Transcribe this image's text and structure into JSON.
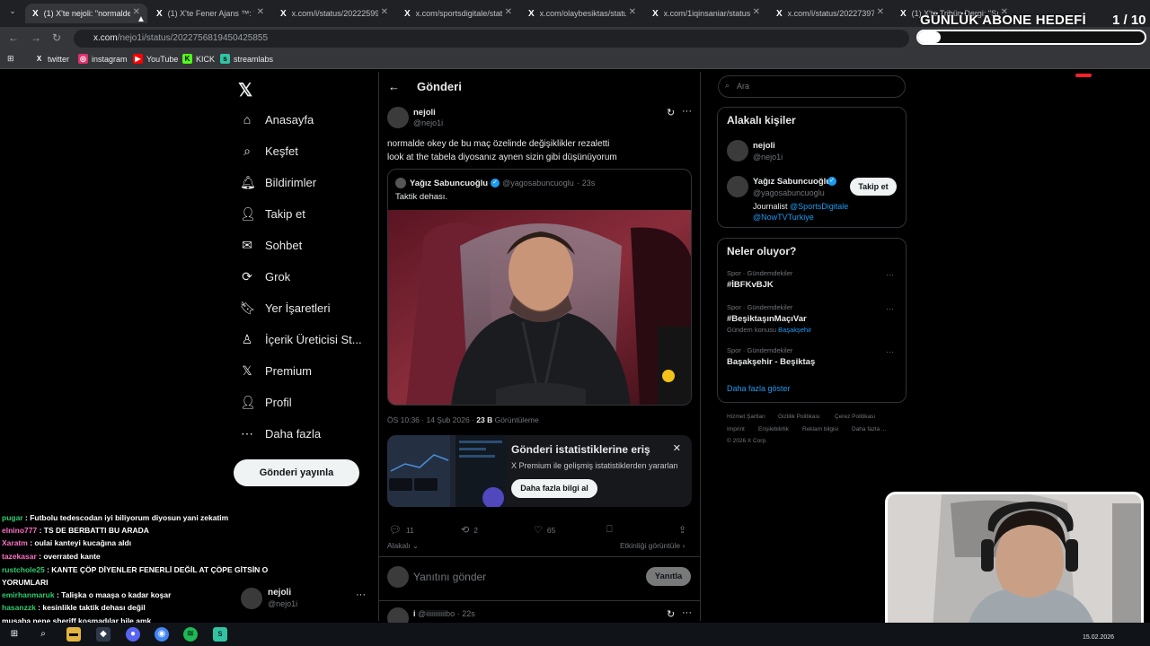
{
  "browser": {
    "tabs": [
      {
        "label": "(1) X'te nejoli: \"normalde",
        "active": true
      },
      {
        "label": "(1) X'te Fener Ajans ™: \"D"
      },
      {
        "label": "x.com/i/status/20222599"
      },
      {
        "label": "x.com/sportsdigitale/statu"
      },
      {
        "label": "x.com/olaybesiktas/statu"
      },
      {
        "label": "x.com/1iqinsaniar/status/"
      },
      {
        "label": "x.com/i/status/20227397"
      },
      {
        "label": "(1) X'te Tribün Dergi: \"Sır"
      }
    ],
    "url_host": "x.com",
    "url_path": "/nejo1i/status/2022756819450425855",
    "bookmarks": [
      "twitter",
      "instagram",
      "YouTube",
      "KICK",
      "streamlabs"
    ]
  },
  "overlay": {
    "goal_title": "GÜNLÜK ABONE HEDEFİ",
    "goal_count": "1 / 10",
    "goal_progress": 0.1
  },
  "nav": {
    "items": [
      "Anasayfa",
      "Keşfet",
      "Bildirimler",
      "Takip et",
      "Sohbet",
      "Grok",
      "Yer İşaretleri",
      "İçerik Üreticisi St...",
      "Premium",
      "Profil",
      "Daha fazla"
    ],
    "post_button": "Gönderi yayınla",
    "account_name": "nejoli",
    "account_handle": "@nejo1i"
  },
  "chat": [
    {
      "user": "pugar",
      "text": "Futbolu tedescodan iyi biliyorum diyosun yani zekatim",
      "color": "#2ecc71"
    },
    {
      "user": "elnino777",
      "text": "TS DE BERBATTI BU ARADA",
      "color": "#ff6ec7"
    },
    {
      "user": "Xaratm",
      "text": "oulai kanteyi kucağına aldı",
      "color": "#ff6ec7"
    },
    {
      "user": "tazekasar",
      "text": "overrated kante",
      "color": "#ff6ec7"
    },
    {
      "user": "rustchole25",
      "text": "KANTE ÇÖP DİYENLER FENERLİ DEĞİL AT ÇÖPE GİTSİN O",
      "color": "#2ecc71"
    },
    {
      "user": "",
      "text": "YORUMLARI",
      "color": "#fff"
    },
    {
      "user": "emirhanmaruk",
      "text": "Talişka o maaşa o kadar koşar",
      "color": "#2ecc71"
    },
    {
      "user": "hasanzzk",
      "text": "kesinlikle taktik dehası değil",
      "color": "#2ecc71"
    },
    {
      "user": "",
      "text": "musaba nene sheriff koşmadılar bile amk",
      "color": "#ff4d4d"
    }
  ],
  "post": {
    "header_title": "Gönderi",
    "author_name": "nejoli",
    "author_handle": "@nejo1i",
    "text_line1": "normalde okey de bu maç özelinde değişiklikler rezaletti",
    "text_line2": "look at the tabela diyosanız aynen sizin gibi düşünüyorum",
    "quote_name": "Yağız Sabuncuoğlu",
    "quote_handle": "@yagosabuncuoglu",
    "quote_time": "23s",
    "quote_text": "Taktik dehası.",
    "timestamp": "ÖS 10:36 · 14 Şub 2026 ·",
    "views_count": "23 B",
    "views_label": "Görüntüleme",
    "promo_title": "Gönderi istatistiklerine eriş",
    "promo_desc": "X Premium ile gelişmiş istatistiklerden yararlan",
    "promo_button": "Daha fazla bilgi al",
    "replies": "11",
    "reposts": "2",
    "likes": "65",
    "sort_label": "Alakalı",
    "activity_link": "Etkinliği görüntüle",
    "reply_placeholder": "Yanıtını gönder",
    "reply_button": "Yanıtla",
    "next_reply_handle": "@iiiiiiiiiiibo",
    "next_reply_time": "22s",
    "next_reply_name": "i"
  },
  "sidebar": {
    "search_placeholder": "Ara",
    "related_title": "Alakalı kişiler",
    "person1_name": "nejoli",
    "person1_handle": "@nejo1i",
    "person2_name": "Yağız Sabuncuoğlu",
    "person2_handle": "@yagosabuncuoglu",
    "person2_bio": "Journalist",
    "person2_link1": "@SportsDigitale",
    "person2_link2": "@NowTVTurkiye",
    "follow_button": "Takip et",
    "trends_title": "Neler oluyor?",
    "trends": [
      {
        "category": "Spor · Gündemdekiler",
        "name": "#İBFKvBJK",
        "extra": ""
      },
      {
        "category": "Spor · Gündemdekiler",
        "name": "#BeşiktaşınMaçıVar",
        "extra": "Gündem konusu",
        "extra_link": "Başakşehir"
      },
      {
        "category": "Spor · Gündemdekiler",
        "name": "Başakşehir - Beşiktaş",
        "extra": ""
      }
    ],
    "show_more": "Daha fazla göster",
    "footer": [
      "Hizmet Şartları",
      "Gizlilik Politikası",
      "Çerez Politikası",
      "Imprint",
      "Erişilebilirlik",
      "Reklam bilgisi",
      "Daha fazla ...",
      "© 2026 X Corp."
    ]
  },
  "taskbar": {
    "date": "15.02.2026"
  },
  "colors": {
    "accent": "#1d9bf0",
    "verified": "#1d9bf0"
  }
}
